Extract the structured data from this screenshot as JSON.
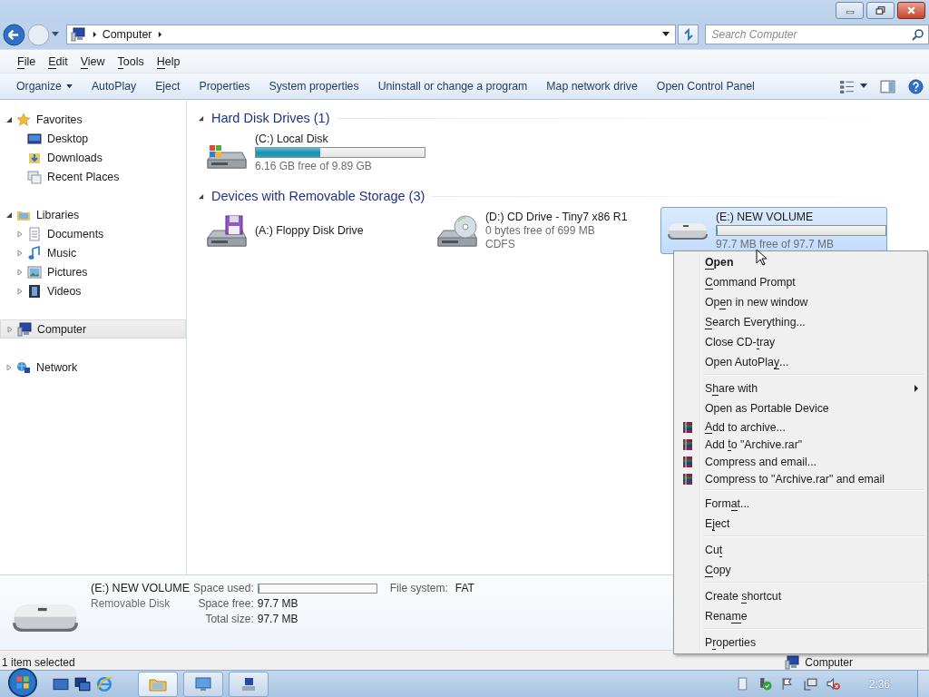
{
  "address_bar": {
    "path": [
      "Computer"
    ],
    "search_placeholder": "Search Computer"
  },
  "menu_bar": [
    {
      "label": [
        {
          "text": "F",
          "underline": true
        },
        {
          "text": "ile",
          "underline": false
        }
      ]
    },
    {
      "label": [
        {
          "text": "E",
          "underline": true
        },
        {
          "text": "dit",
          "underline": false
        }
      ]
    },
    {
      "label": [
        {
          "text": "V",
          "underline": true
        },
        {
          "text": "iew",
          "underline": false
        }
      ]
    },
    {
      "label": [
        {
          "text": "T",
          "underline": true
        },
        {
          "text": "ools",
          "underline": false
        }
      ]
    },
    {
      "label": [
        {
          "text": "H",
          "underline": true
        },
        {
          "text": "elp",
          "underline": false
        }
      ]
    }
  ],
  "command_bar": [
    {
      "label": "Organize",
      "dropdown": true
    },
    {
      "label": "AutoPlay",
      "dropdown": false
    },
    {
      "label": "Eject",
      "dropdown": false
    },
    {
      "label": "Properties",
      "dropdown": false
    },
    {
      "label": "System properties",
      "dropdown": false
    },
    {
      "label": "Uninstall or change a program",
      "dropdown": false
    },
    {
      "label": "Map network drive",
      "dropdown": false
    },
    {
      "label": "Open Control Panel",
      "dropdown": false
    }
  ],
  "navigation": [
    {
      "label": "Favorites",
      "kind": "star",
      "expanded": true,
      "selected": false,
      "children": [
        {
          "label": "Desktop",
          "kind": "desktop",
          "selected": false
        },
        {
          "label": "Downloads",
          "kind": "downloads",
          "selected": false
        },
        {
          "label": "Recent Places",
          "kind": "recent",
          "selected": false
        }
      ]
    },
    {
      "label": "Libraries",
      "kind": "libraries",
      "expanded": true,
      "selected": false,
      "children": [
        {
          "label": "Documents",
          "kind": "documents",
          "expanded": false,
          "selected": false
        },
        {
          "label": "Music",
          "kind": "music",
          "expanded": false,
          "selected": false
        },
        {
          "label": "Pictures",
          "kind": "pictures",
          "expanded": false,
          "selected": false
        },
        {
          "label": "Videos",
          "kind": "videos",
          "expanded": false,
          "selected": false
        }
      ]
    },
    {
      "label": "Computer",
      "kind": "computer",
      "expanded": false,
      "selected": true
    },
    {
      "label": "Network",
      "kind": "network",
      "expanded": false,
      "selected": false
    }
  ],
  "groups": [
    {
      "title": "Hard Disk Drives (1)",
      "expanded": true,
      "drives": [
        {
          "name": "(C:) Local Disk",
          "kind": "hdd",
          "selected": false,
          "level": 0.38,
          "free": "6.16 GB free of 9.89 GB"
        }
      ]
    },
    {
      "title": "Devices with Removable Storage (3)",
      "expanded": true,
      "drives": [
        {
          "name": "(A:) Floppy Disk Drive",
          "kind": "floppy",
          "selected": false
        },
        {
          "name": "(D:) CD Drive - Tiny7 x86 R1",
          "kind": "cd",
          "selected": false,
          "free": "0 bytes free of 699 MB",
          "file_system": "CDFS"
        },
        {
          "name": "(E:) NEW VOLUME",
          "kind": "removable",
          "selected": true,
          "level": 0,
          "free": "97.7 MB free of 97.7 MB"
        }
      ]
    }
  ],
  "details": {
    "name": "(E:) NEW VOLUME",
    "type": "Removable Disk",
    "space_used": {
      "label": "Space used:",
      "level": 0
    },
    "fields": [
      {
        "label": "Space free:",
        "value": "97.7 MB"
      },
      {
        "label": "Total size:",
        "value": "97.7 MB"
      }
    ],
    "file_system": {
      "label": "File system:",
      "value": "FAT"
    }
  },
  "status_bar": {
    "text": "1 item selected",
    "location": "Computer"
  },
  "context_menu": [
    {
      "kind": "item",
      "default": true,
      "submenu": false,
      "label": [
        {
          "text": "O",
          "underline": true
        },
        {
          "text": "pen",
          "underline": false
        }
      ]
    },
    {
      "kind": "item",
      "default": false,
      "submenu": false,
      "label": [
        {
          "text": "C",
          "underline": true
        },
        {
          "text": "ommand Prompt",
          "underline": false
        }
      ]
    },
    {
      "kind": "item",
      "default": false,
      "submenu": false,
      "label": [
        {
          "text": "Op",
          "underline": false
        },
        {
          "text": "e",
          "underline": true
        },
        {
          "text": "n in new window",
          "underline": false
        }
      ]
    },
    {
      "kind": "item",
      "default": false,
      "submenu": false,
      "label": [
        {
          "text": "S",
          "underline": true
        },
        {
          "text": "earch Everything...",
          "underline": false
        }
      ]
    },
    {
      "kind": "item",
      "default": false,
      "submenu": false,
      "label": [
        {
          "text": "Close CD-",
          "underline": false
        },
        {
          "text": "t",
          "underline": true
        },
        {
          "text": "ray",
          "underline": false
        }
      ]
    },
    {
      "kind": "item",
      "default": false,
      "submenu": false,
      "label": [
        {
          "text": "Open AutoPla",
          "underline": false
        },
        {
          "text": "y",
          "underline": true
        },
        {
          "text": "...",
          "underline": false
        }
      ]
    },
    {
      "kind": "separator"
    },
    {
      "kind": "item",
      "default": false,
      "submenu": true,
      "label": [
        {
          "text": "S",
          "underline": false
        },
        {
          "text": "h",
          "underline": true
        },
        {
          "text": "are with",
          "underline": false
        }
      ]
    },
    {
      "kind": "item",
      "default": false,
      "submenu": false,
      "label": [
        {
          "text": "Open as Portable Device",
          "underline": false
        }
      ]
    },
    {
      "kind": "archive-item",
      "default": false,
      "submenu": false,
      "label": [
        {
          "text": "A",
          "underline": true
        },
        {
          "text": "dd to archive...",
          "underline": false
        }
      ]
    },
    {
      "kind": "archive-item",
      "default": false,
      "submenu": false,
      "label": [
        {
          "text": "Add ",
          "underline": false
        },
        {
          "text": "t",
          "underline": true
        },
        {
          "text": "o \"Archive.rar\"",
          "underline": false
        }
      ]
    },
    {
      "kind": "archive-item",
      "default": false,
      "submenu": false,
      "label": [
        {
          "text": "Compress and email...",
          "underline": false
        }
      ]
    },
    {
      "kind": "archive-item",
      "default": false,
      "submenu": false,
      "label": [
        {
          "text": "Compress to \"Archive.rar\" and email",
          "underline": false
        }
      ]
    },
    {
      "kind": "separator"
    },
    {
      "kind": "item",
      "default": false,
      "submenu": false,
      "label": [
        {
          "text": "Form",
          "underline": false
        },
        {
          "text": "a",
          "underline": true
        },
        {
          "text": "t...",
          "underline": false
        }
      ]
    },
    {
      "kind": "item",
      "default": false,
      "submenu": false,
      "label": [
        {
          "text": "E",
          "underline": false
        },
        {
          "text": "j",
          "underline": true
        },
        {
          "text": "ect",
          "underline": false
        }
      ]
    },
    {
      "kind": "separator"
    },
    {
      "kind": "item",
      "default": false,
      "submenu": false,
      "label": [
        {
          "text": "Cu",
          "underline": false
        },
        {
          "text": "t",
          "underline": true
        }
      ]
    },
    {
      "kind": "item",
      "default": false,
      "submenu": false,
      "label": [
        {
          "text": "C",
          "underline": true
        },
        {
          "text": "opy",
          "underline": false
        }
      ]
    },
    {
      "kind": "separator"
    },
    {
      "kind": "item",
      "default": false,
      "submenu": false,
      "label": [
        {
          "text": "Create ",
          "underline": false
        },
        {
          "text": "s",
          "underline": true
        },
        {
          "text": "hortcut",
          "underline": false
        }
      ]
    },
    {
      "kind": "item",
      "default": false,
      "submenu": false,
      "label": [
        {
          "text": "Rena",
          "underline": false
        },
        {
          "text": "m",
          "underline": true
        },
        {
          "text": "e",
          "underline": false
        }
      ]
    },
    {
      "kind": "separator"
    },
    {
      "kind": "item",
      "default": false,
      "submenu": false,
      "label": [
        {
          "text": "P",
          "underline": false
        },
        {
          "text": "r",
          "underline": true
        },
        {
          "text": "operties",
          "underline": false
        }
      ]
    }
  ],
  "taskbar": {
    "clock": "2:36"
  }
}
